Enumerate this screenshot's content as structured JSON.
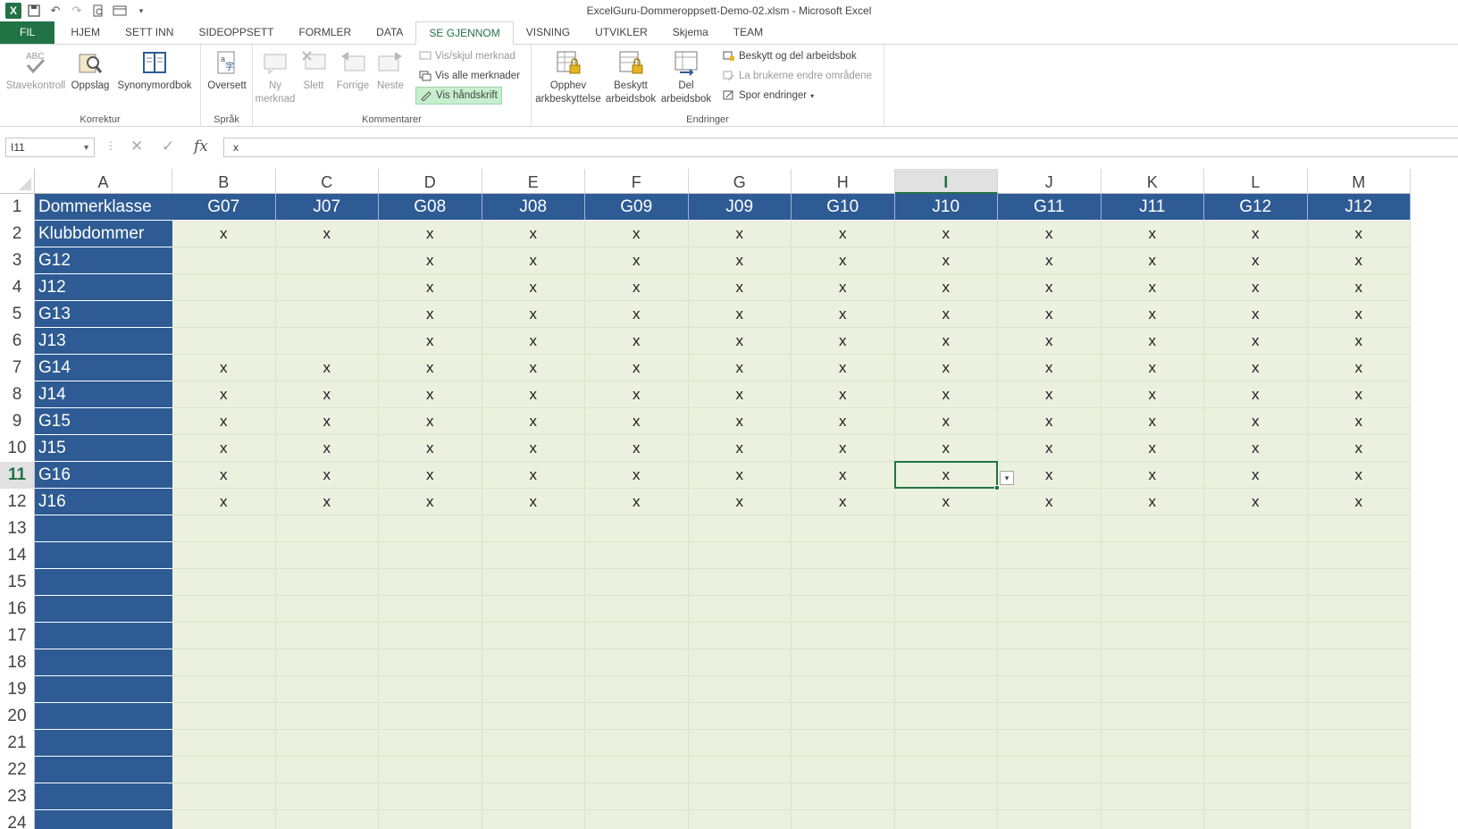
{
  "titlebar": {
    "title": "ExcelGuru-Dommeroppsett-Demo-02.xlsm - Microsoft Excel"
  },
  "tabs": [
    "FIL",
    "HJEM",
    "SETT INN",
    "SIDEOPPSETT",
    "FORMLER",
    "DATA",
    "SE GJENNOM",
    "VISNING",
    "UTVIKLER",
    "Skjema",
    "TEAM"
  ],
  "ribbon": {
    "korrektur": {
      "label": "Korrektur",
      "stavekontroll": "Stavekontroll",
      "oppslag": "Oppslag",
      "synonymordbok": "Synonymordbok"
    },
    "sprak": {
      "label": "Språk",
      "oversett": "Oversett"
    },
    "kommentarer": {
      "label": "Kommentarer",
      "ny_line1": "Ny",
      "ny_line2": "merknad",
      "slett": "Slett",
      "forrige": "Forrige",
      "neste": "Neste",
      "vis_skjul": "Vis/skjul merknad",
      "vis_alle": "Vis alle merknader",
      "vis_handskrift": "Vis håndskrift"
    },
    "endringer": {
      "label": "Endringer",
      "opphev_line1": "Opphev",
      "opphev_line2": "arkbeskyttelse",
      "beskytt_line1": "Beskytt",
      "beskytt_line2": "arbeidsbok",
      "del_line1": "Del",
      "del_line2": "arbeidsbok",
      "beskytt_og_del": "Beskytt og del arbeidsbok",
      "la_brukerne": "La brukerne endre områdene",
      "spor_endringer": "Spor endringer"
    }
  },
  "formula_bar": {
    "name_box": "I11",
    "fx": "fx",
    "value": "x"
  },
  "sheet": {
    "columns": [
      "A",
      "B",
      "C",
      "D",
      "E",
      "F",
      "G",
      "H",
      "I",
      "J",
      "K",
      "L",
      "M"
    ],
    "selected_column": "I",
    "selected_row": 11,
    "header_row": [
      "Dommerklasse",
      "G07",
      "J07",
      "G08",
      "J08",
      "G09",
      "J09",
      "G10",
      "J10",
      "G11",
      "J11",
      "G12",
      "J12"
    ],
    "rows": [
      [
        "Klubbdommer",
        "x",
        "x",
        "x",
        "x",
        "x",
        "x",
        "x",
        "x",
        "x",
        "x",
        "x",
        "x"
      ],
      [
        "G12",
        "",
        "",
        "x",
        "x",
        "x",
        "x",
        "x",
        "x",
        "x",
        "x",
        "x",
        "x"
      ],
      [
        "J12",
        "",
        "",
        "x",
        "x",
        "x",
        "x",
        "x",
        "x",
        "x",
        "x",
        "x",
        "x"
      ],
      [
        "G13",
        "",
        "",
        "x",
        "x",
        "x",
        "x",
        "x",
        "x",
        "x",
        "x",
        "x",
        "x"
      ],
      [
        "J13",
        "",
        "",
        "x",
        "x",
        "x",
        "x",
        "x",
        "x",
        "x",
        "x",
        "x",
        "x"
      ],
      [
        "G14",
        "x",
        "x",
        "x",
        "x",
        "x",
        "x",
        "x",
        "x",
        "x",
        "x",
        "x",
        "x"
      ],
      [
        "J14",
        "x",
        "x",
        "x",
        "x",
        "x",
        "x",
        "x",
        "x",
        "x",
        "x",
        "x",
        "x"
      ],
      [
        "G15",
        "x",
        "x",
        "x",
        "x",
        "x",
        "x",
        "x",
        "x",
        "x",
        "x",
        "x",
        "x"
      ],
      [
        "J15",
        "x",
        "x",
        "x",
        "x",
        "x",
        "x",
        "x",
        "x",
        "x",
        "x",
        "x",
        "x"
      ],
      [
        "G16",
        "x",
        "x",
        "x",
        "x",
        "x",
        "x",
        "x",
        "x",
        "x",
        "x",
        "x",
        "x"
      ],
      [
        "J16",
        "x",
        "x",
        "x",
        "x",
        "x",
        "x",
        "x",
        "x",
        "x",
        "x",
        "x",
        "x"
      ]
    ],
    "row_numbers": [
      "1",
      "2",
      "3",
      "4",
      "5",
      "6",
      "7",
      "8",
      "9",
      "10",
      "11",
      "12",
      "13",
      "14",
      "15",
      "16",
      "17",
      "18",
      "19",
      "20",
      "21",
      "22",
      "23",
      "24"
    ],
    "colors": {
      "header_fill": "#2e5b94",
      "data_fill": "#ebf1de",
      "accent": "#217346"
    }
  }
}
